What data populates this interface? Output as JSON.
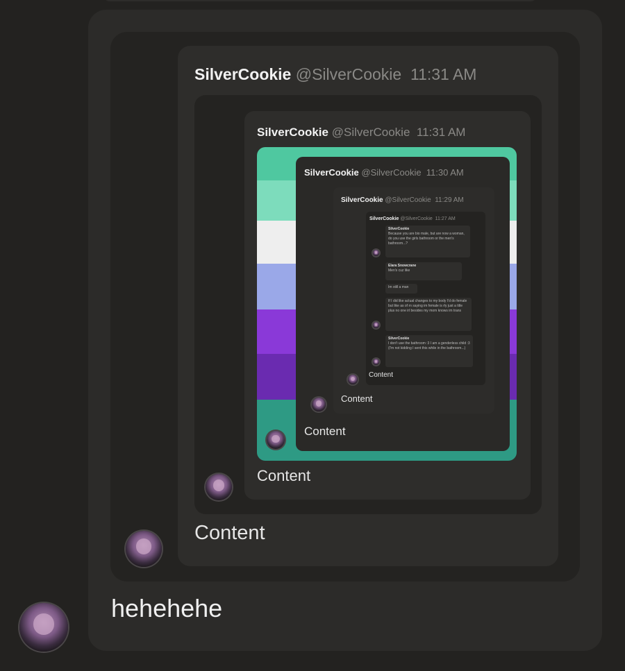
{
  "colors": {
    "background": "#232220",
    "card": "#2e2d2b",
    "quote": "#242321",
    "flag": [
      "#4fc8a0",
      "#7ddcbc",
      "#f2f2f2",
      "#9aa8e8",
      "#8a39d8",
      "#6a2bb0",
      "#2e9a84"
    ]
  },
  "icons": [
    "avatar-silvercookie"
  ],
  "message": {
    "text": "hehehehe",
    "embed": {
      "username": "SilverCookie",
      "handle": "@SilverCookie",
      "time": "11:31 AM",
      "content": "Content",
      "embed": {
        "username": "SilverCookie",
        "handle": "@SilverCookie",
        "time": "11:31 AM",
        "content": "Content",
        "embed": {
          "username": "SilverCookie",
          "handle": "@SilverCookie",
          "time": "11:30 AM",
          "content": "Content",
          "embed": {
            "username": "SilverCookie",
            "handle": "@SilverCookie",
            "time": "11:29 AM",
            "content": "Content",
            "embed": {
              "username": "SilverCookie",
              "handle": "@SilverCookie",
              "time": "11:27 AM",
              "content": "Content",
              "chat": [
                {
                  "author": "SilverCookie",
                  "text": "Because you are bio male, but are now a woman, do you use the girls bathroom or the men's bathroom...?"
                },
                {
                  "author": "Elara Snowcrane",
                  "text": "Men's cuz like"
                },
                {
                  "author": "",
                  "text": "Im still a man"
                },
                {
                  "author": "",
                  "text": "If I did like actual changes to my body I'd do female but like as of rn saying im female is rly just a title plus no one irl besides my mom knows im trans"
                },
                {
                  "author": "SilverCookie",
                  "text": "I don't use the bathroom :3 I am a genderless child :3 (I'm not kidding I sent this while in the bathroom...)"
                }
              ]
            }
          }
        }
      }
    }
  }
}
